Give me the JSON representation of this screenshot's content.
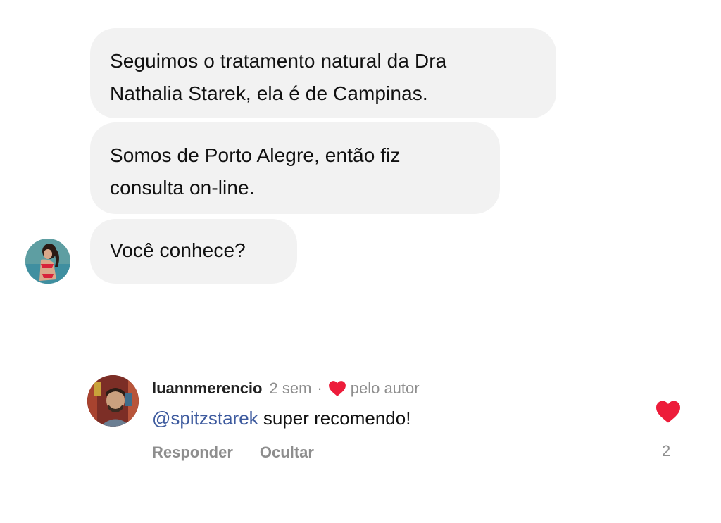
{
  "messages": [
    {
      "lines": [
        "Seguimos o tratamento natural da Dra",
        "Nathalia Starek, ela é de Campinas."
      ]
    },
    {
      "lines": [
        "Somos de Porto Alegre, então fiz",
        "consulta on-line."
      ]
    },
    {
      "lines": [
        "Você conhece?"
      ]
    }
  ],
  "comment": {
    "username": "luannmerencio",
    "time": "2 sem",
    "separator": "·",
    "liked_by_label": "pelo autor",
    "mention": "@spitzstarek",
    "text": " super recomendo!",
    "reply_label": "Responder",
    "hide_label": "Ocultar",
    "like_count": "2",
    "heart_color": "#ed1c3a",
    "heart_icon": "heart-icon"
  }
}
